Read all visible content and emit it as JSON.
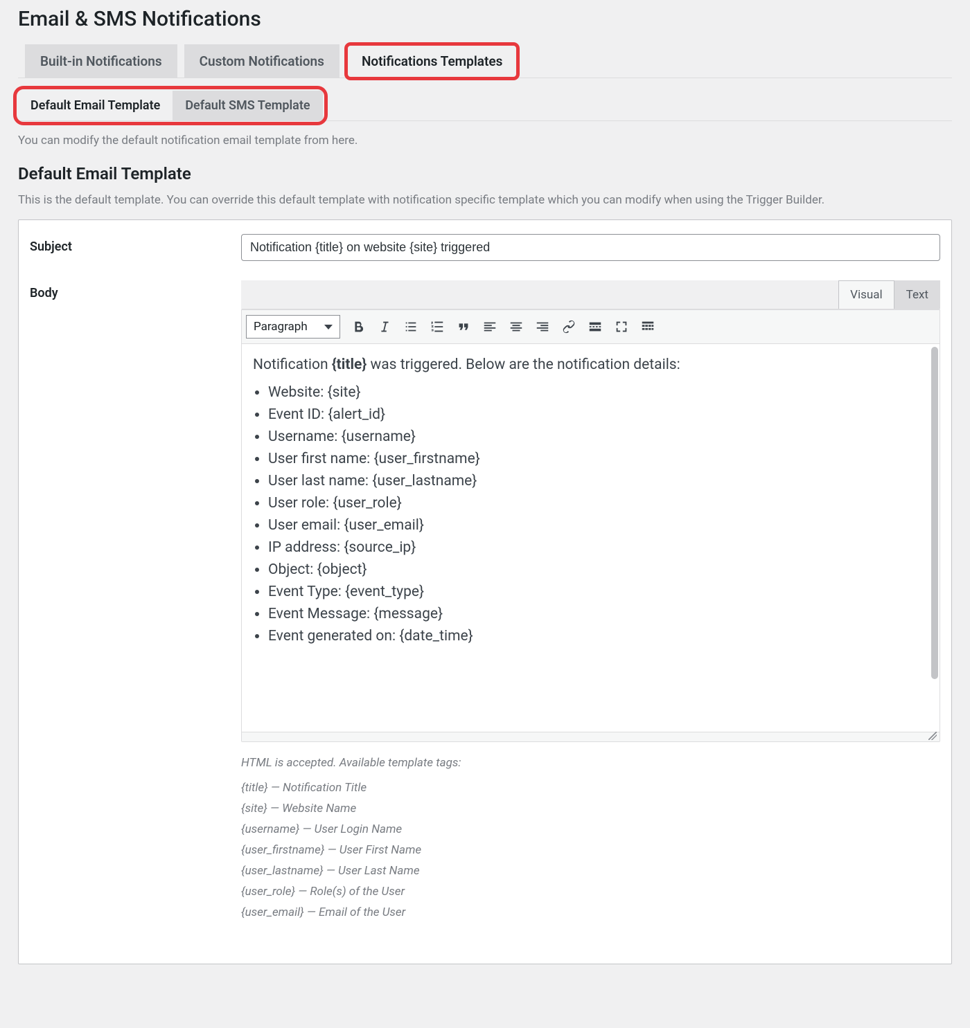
{
  "page_title": "Email & SMS Notifications",
  "tabs": {
    "builtin": "Built-in Notifications",
    "custom": "Custom Notifications",
    "templates": "Notifications Templates"
  },
  "sub_tabs": {
    "email": "Default Email Template",
    "sms": "Default SMS Template"
  },
  "intro_text": "You can modify the default notification email template from here.",
  "section_title": "Default Email Template",
  "section_desc": "This is the default template. You can override this default template with notification specific template which you can modify when using the Trigger Builder.",
  "labels": {
    "subject": "Subject",
    "body": "Body"
  },
  "subject_value": "Notification {title} on website {site} triggered",
  "editor": {
    "tabs": {
      "visual": "Visual",
      "text": "Text"
    },
    "format_select": "Paragraph",
    "body_prefix": "Notification ",
    "body_bold": "{title}",
    "body_suffix": " was triggered. Below are the notification details:",
    "bullets": [
      "Website: {site}",
      "Event ID: {alert_id}",
      "Username: {username}",
      "User first name: {user_firstname}",
      "User last name: {user_lastname}",
      "User role: {user_role}",
      "User email: {user_email}",
      "IP address: {source_ip}",
      "Object: {object}",
      "Event Type: {event_type}",
      "Event Message: {message}",
      "Event generated on: {date_time}"
    ]
  },
  "tags_hint": "HTML is accepted. Available template tags:",
  "tags": [
    "{title} — Notification Title",
    "{site} — Website Name",
    "{username} — User Login Name",
    "{user_firstname} — User First Name",
    "{user_lastname} — User Last Name",
    "{user_role} — Role(s) of the User",
    "{user_email} — Email of the User"
  ]
}
